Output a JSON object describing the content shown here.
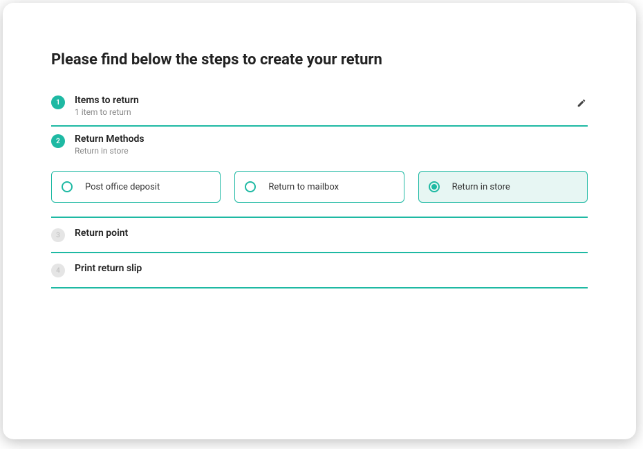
{
  "page": {
    "title": "Please find below the steps to create your return"
  },
  "steps": {
    "items_to_return": {
      "number": "1",
      "label": "Items to return",
      "sublabel": "1 item to return"
    },
    "return_methods": {
      "number": "2",
      "label": "Return Methods",
      "sublabel": "Return in store",
      "options": {
        "post_office": "Post office deposit",
        "mailbox": "Return to mailbox",
        "in_store": "Return in store"
      }
    },
    "return_point": {
      "number": "3",
      "label": "Return point"
    },
    "print_slip": {
      "number": "4",
      "label": "Print return slip"
    }
  },
  "colors": {
    "accent": "#1eb9a3",
    "selected_bg": "#e7f6f3"
  }
}
